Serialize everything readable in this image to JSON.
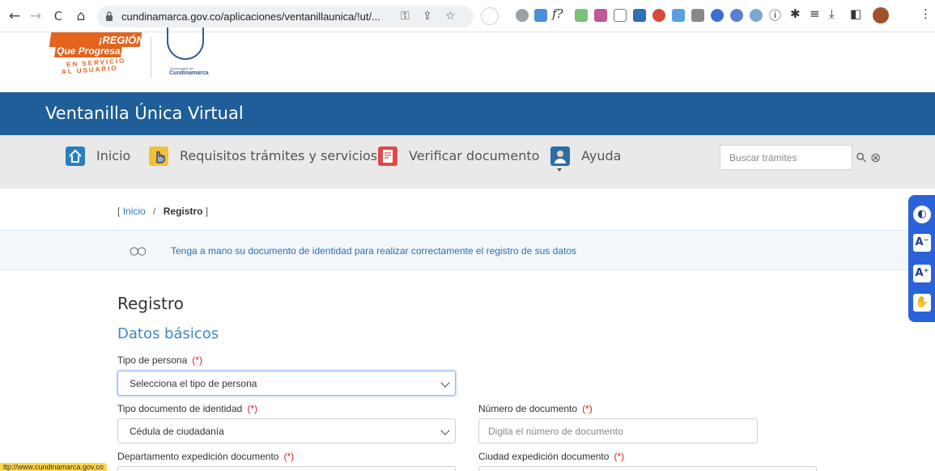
{
  "browser": {
    "back_glyph": "←",
    "forward_glyph": "→",
    "reload_glyph": "C",
    "home_glyph": "⌂",
    "url": "cundinamarca.gov.co/aplicaciones/ventanillaunica/!ut/...",
    "key_glyph": "⚿",
    "share_glyph": "⇪",
    "star_glyph": "☆",
    "menu_glyph": "⋮",
    "extensions_glyph": "✱",
    "download_glyph": "⤓",
    "sidepanel_glyph": "◧",
    "readinglist_glyph": "≡",
    "fx_glyph": "f?",
    "info_glyph": "ⓘ"
  },
  "logos": {
    "region_line1": "¡REGIÓN",
    "region_line2": "Que Progresa!",
    "region_line3": "EN SERVICIO",
    "region_line4": "AL USUARIO",
    "gob_small": "Gobernación de",
    "gob_name": "Cundinamarca"
  },
  "header": {
    "title": "Ventanilla Única Virtual",
    "color": "#1f5e98"
  },
  "menu": {
    "items": [
      {
        "label": "Inicio",
        "icon": "home-icon"
      },
      {
        "label": "Requisitos trámites y servicios",
        "icon": "hand-pointer-icon"
      },
      {
        "label": "Verificar documento",
        "icon": "document-check-icon"
      },
      {
        "label": "Ayuda",
        "icon": "help-person-icon"
      }
    ],
    "search_placeholder": "Buscar trámites",
    "search_glyph": "⚲",
    "clear_glyph": "⊗"
  },
  "breadcrumb": {
    "open": "[",
    "home": "Inicio",
    "separator": "/",
    "current": "Registro",
    "close": "]"
  },
  "info": {
    "icon_glyph": "○○",
    "text": "Tenga a mano su documento de identidad para realizar correctamente el registro de sus datos"
  },
  "form": {
    "title": "Registro",
    "subtitle": "Datos básicos",
    "required_mark": "(*)",
    "fields": {
      "tipo_persona": {
        "label": "Tipo de persona",
        "value": "Selecciona el tipo de persona"
      },
      "tipo_documento": {
        "label": "Tipo documento de identidad",
        "value": "Cédula de ciudadanía"
      },
      "numero_documento": {
        "label": "Número de documento",
        "placeholder": "Digita el número de documento"
      },
      "departamento": {
        "label": "Departamento expedición documento"
      },
      "ciudad": {
        "label": "Ciudad expedición documento"
      }
    }
  },
  "accessibility": {
    "contrast_glyph": "◐",
    "font_decrease": "A⁻",
    "font_increase": "A⁺",
    "sign_language_glyph": "✋"
  },
  "status_bar": {
    "text": "ttp://www.cundinamarca.gov.co"
  }
}
